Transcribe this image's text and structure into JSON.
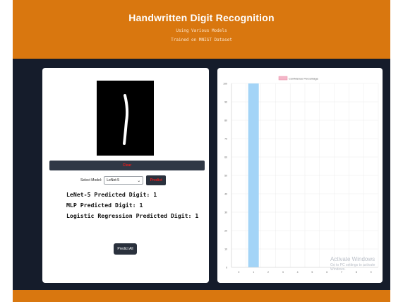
{
  "header": {
    "title": "Handwritten Digit Recognition",
    "subtitle1": "Using Various Models",
    "subtitle2": "Trained on MNIST Dataset"
  },
  "left": {
    "clear_label": "Clear",
    "select_label": "Select Model:",
    "select_value": "LeNet-5",
    "predict_label": "Predict",
    "results": [
      "LeNet-5 Predicted Digit: 1",
      "MLP Predicted Digit: 1",
      "Logistic Regression Predicted Digit: 1"
    ],
    "predict_all_label": "Predict All"
  },
  "watermark": {
    "line1": "Activate Windows",
    "line2": "Go to PC settings to activate Windows."
  },
  "colors": {
    "header": "#d9770f",
    "background": "#151c2b",
    "bar_fill": "#a3d4f7",
    "legend_fill": "#f4b6c8"
  },
  "chart_data": {
    "type": "bar",
    "legend": "Confidence Percentage",
    "categories": [
      "0",
      "1",
      "2",
      "3",
      "4",
      "5",
      "6",
      "7",
      "8",
      "9"
    ],
    "values": [
      0,
      100,
      0,
      0,
      0,
      0,
      0,
      0,
      0,
      0
    ],
    "ylim": [
      0,
      100
    ],
    "yticks": [
      0,
      10,
      20,
      30,
      40,
      50,
      60,
      70,
      80,
      90,
      100
    ],
    "grid": true,
    "legend_position": "top"
  }
}
